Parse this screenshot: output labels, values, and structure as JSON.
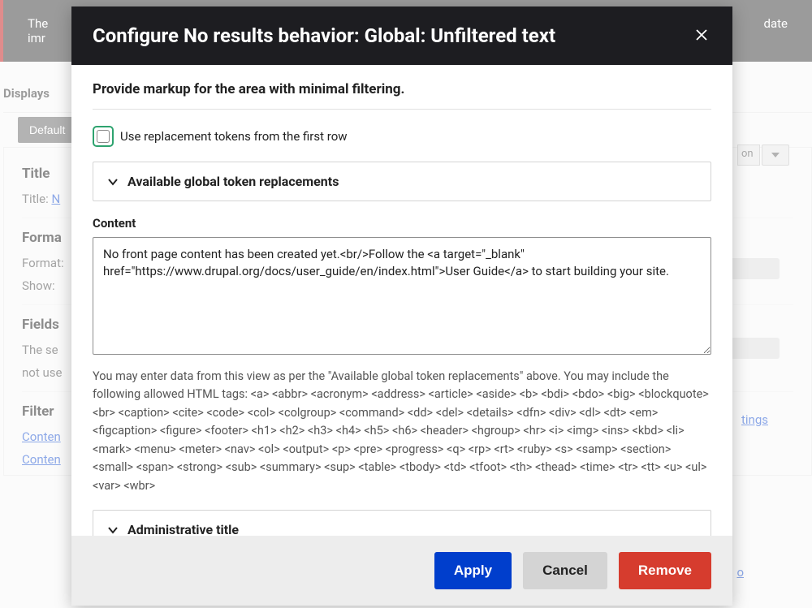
{
  "background": {
    "banner_prefix": "The",
    "banner_suffix": "date",
    "banner_line2": "imr",
    "displays_label": "Displays",
    "default_btn": "Default",
    "on_text": "on",
    "section_title": "Title",
    "title_row_label": "Title:",
    "title_link_char": "N",
    "format_title": "Forma",
    "format_row_label": "Format:",
    "show_row_label": "Show:",
    "fields_title": "Fields",
    "fields_body_1": "The se",
    "fields_body_2": "not use",
    "filter_title": "Filter",
    "content_link_1": "Conten",
    "content_link_2": "Conten",
    "settings_link": "tings",
    "right_o": "o"
  },
  "modal": {
    "title": "Configure No results behavior: Global: Unfiltered text",
    "subtitle": "Provide markup for the area with minimal filtering.",
    "checkbox_label": "Use replacement tokens from the first row",
    "collapse1_title": "Available global token replacements",
    "content_label": "Content",
    "textarea_value": "No front page content has been created yet.<br/>Follow the <a target=\"_blank\" href=\"https://www.drupal.org/docs/user_guide/en/index.html\">User Guide</a> to start building your site.",
    "help_text": "You may enter data from this view as per the \"Available global token replacements\" above. You may include the following allowed HTML tags: <a> <abbr> <acronym> <address> <article> <aside> <b> <bdi> <bdo> <big> <blockquote> <br> <caption> <cite> <code> <col> <colgroup> <command> <dd> <del> <details> <dfn> <div> <dl> <dt> <em> <figcaption> <figure> <footer> <h1> <h2> <h3> <h4> <h5> <h6> <header> <hgroup> <hr> <i> <img> <ins> <kbd> <li> <mark> <menu> <meter> <nav> <ol> <output> <p> <pre> <progress> <q> <rp> <rt> <ruby> <s> <samp> <section> <small> <span> <strong> <sub> <summary> <sup> <table> <tbody> <td> <tfoot> <th> <thead> <time> <tr> <tt> <u> <ul> <var> <wbr>",
    "collapse2_title": "Administrative title",
    "apply_btn": "Apply",
    "cancel_btn": "Cancel",
    "remove_btn": "Remove"
  }
}
